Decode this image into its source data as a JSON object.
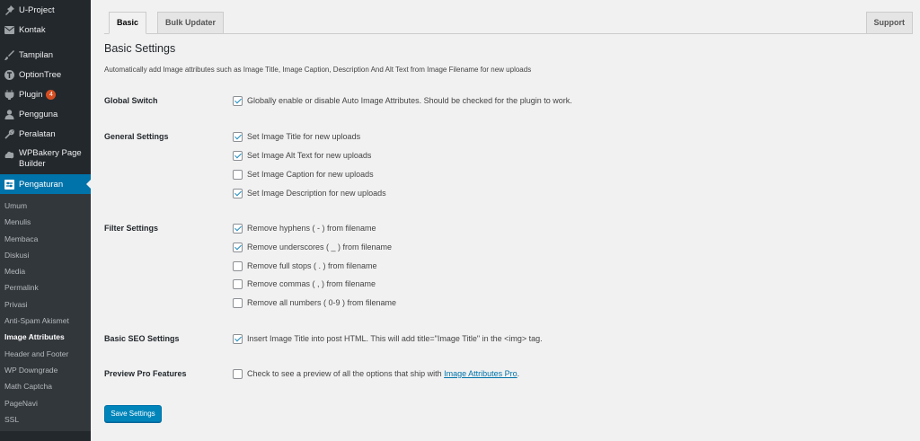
{
  "sidebar": {
    "items": [
      {
        "label": "U-Project",
        "icon": "pin-icon"
      },
      {
        "label": "Kontak",
        "icon": "mail-icon"
      },
      {
        "label": "Tampilan",
        "icon": "brush-icon"
      },
      {
        "label": "OptionTree",
        "icon": "optiontree-icon"
      },
      {
        "label": "Plugin",
        "icon": "plugin-icon",
        "badge": "4"
      },
      {
        "label": "Pengguna",
        "icon": "user-icon"
      },
      {
        "label": "Peralatan",
        "icon": "wrench-icon"
      },
      {
        "label": "WPBakery Page Builder",
        "icon": "wpbakery-icon"
      },
      {
        "label": "Pengaturan",
        "icon": "settings-icon"
      }
    ],
    "submenu": [
      "Umum",
      "Menulis",
      "Membaca",
      "Diskusi",
      "Media",
      "Permalink",
      "Privasi",
      "Anti-Spam Akismet",
      "Image Attributes",
      "Header and Footer",
      "WP Downgrade",
      "Math Captcha",
      "PageNavi",
      "SSL"
    ]
  },
  "tabs": {
    "basic": "Basic",
    "bulk": "Bulk Updater",
    "support": "Support"
  },
  "page": {
    "title": "Basic Settings",
    "description": "Automatically add Image attributes such as Image Title, Image Caption, Description And Alt Text from Image Filename for new uploads"
  },
  "sections": {
    "global": {
      "label": "Global Switch",
      "options": [
        {
          "text": "Globally enable or disable Auto Image Attributes. Should be checked for the plugin to work.",
          "checked": true
        }
      ]
    },
    "general": {
      "label": "General Settings",
      "options": [
        {
          "text": "Set Image Title for new uploads",
          "checked": true
        },
        {
          "text": "Set Image Alt Text for new uploads",
          "checked": true
        },
        {
          "text": "Set Image Caption for new uploads",
          "checked": false
        },
        {
          "text": "Set Image Description for new uploads",
          "checked": true
        }
      ]
    },
    "filter": {
      "label": "Filter Settings",
      "options": [
        {
          "text": "Remove hyphens ( - ) from filename",
          "checked": true
        },
        {
          "text": "Remove underscores ( _ ) from filename",
          "checked": true
        },
        {
          "text": "Remove full stops ( . ) from filename",
          "checked": false
        },
        {
          "text": "Remove commas ( , ) from filename",
          "checked": false
        },
        {
          "text": "Remove all numbers ( 0-9 ) from filename",
          "checked": false
        }
      ]
    },
    "seo": {
      "label": "Basic SEO Settings",
      "options": [
        {
          "text": "Insert Image Title into post HTML. This will add title=\"Image Title\" in the <img> tag.",
          "checked": true
        }
      ]
    },
    "pro": {
      "label": "Preview Pro Features",
      "text_before": "Check to see a preview of all the options that ship with ",
      "link": "Image Attributes Pro",
      "text_after": ".",
      "checked": false
    }
  },
  "save_label": "Save Settings",
  "colors": {
    "sidebar_bg": "#23282d",
    "submenu_bg": "#32373c",
    "accent": "#0073aa",
    "button": "#0085ba",
    "badge": "#d54e21"
  }
}
